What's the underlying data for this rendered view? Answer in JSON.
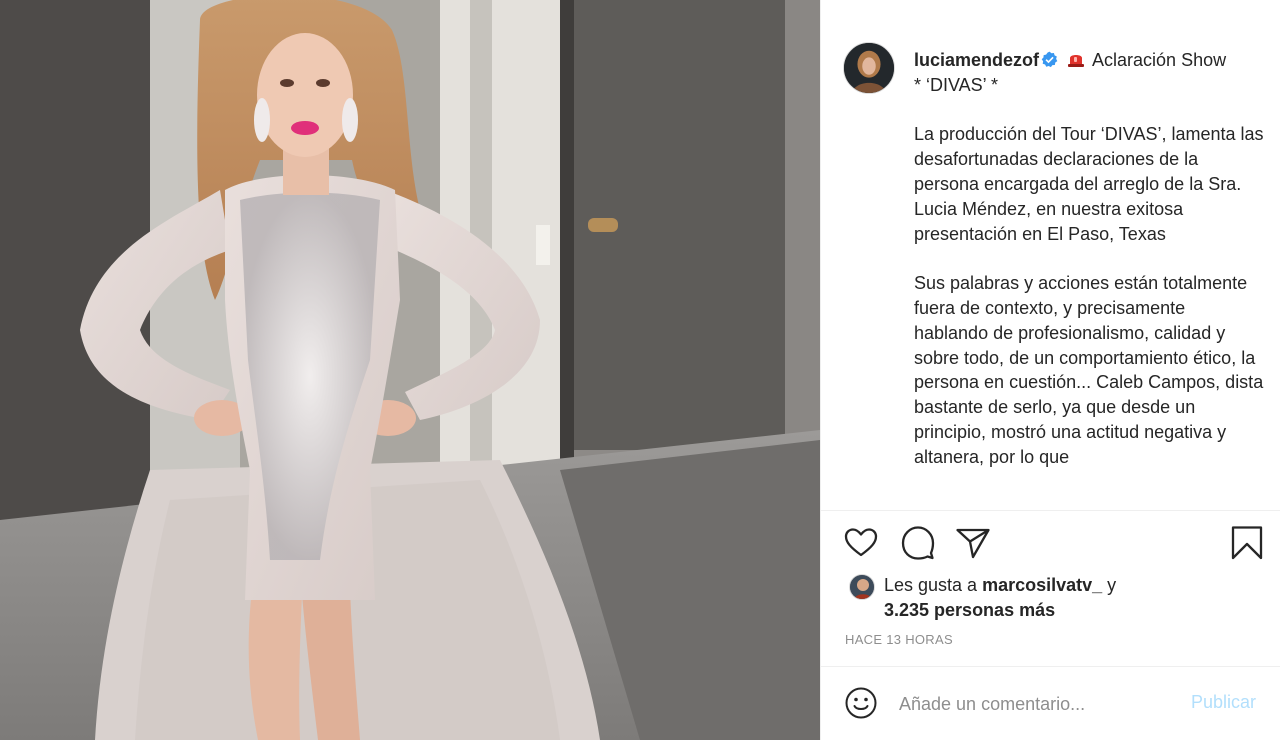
{
  "post": {
    "username": "luciamendezof",
    "verified": true,
    "title_rest": "Aclaración Show",
    "title_line2": "* ‘DIVAS’ *",
    "paragraph1": "La producción del Tour ‘DIVAS’, lamenta las desafortunadas declaraciones de la persona encargada del arreglo de la Sra. Lucia Méndez, en nuestra exitosa presentación en El Paso, Texas",
    "paragraph2": "Sus palabras y acciones están totalmente fuera de contexto, y precisamente hablando de profesionalismo, calidad y sobre todo, de un comportamiento ético, la persona en cuestión... Caleb Campos, dista bastante de serlo, ya que desde un principio, mostró una actitud negativa y altanera, por lo que"
  },
  "actions": {
    "icons": [
      "heart-icon",
      "comment-icon",
      "share-icon",
      "bookmark-icon"
    ]
  },
  "likes": {
    "prefix": "Les gusta a ",
    "user": "marcosilvatv_",
    "connector": " y",
    "others": "3.235 personas más"
  },
  "timestamp": "HACE 13 HORAS",
  "comment_box": {
    "placeholder": "Añade un comentario...",
    "publish_label": "Publicar"
  },
  "colors": {
    "text": "#262626",
    "muted": "#8e8e8e",
    "verified_blue": "#3897f0",
    "publish_disabled": "#b2dffc",
    "siren_red": "#e0322b"
  }
}
